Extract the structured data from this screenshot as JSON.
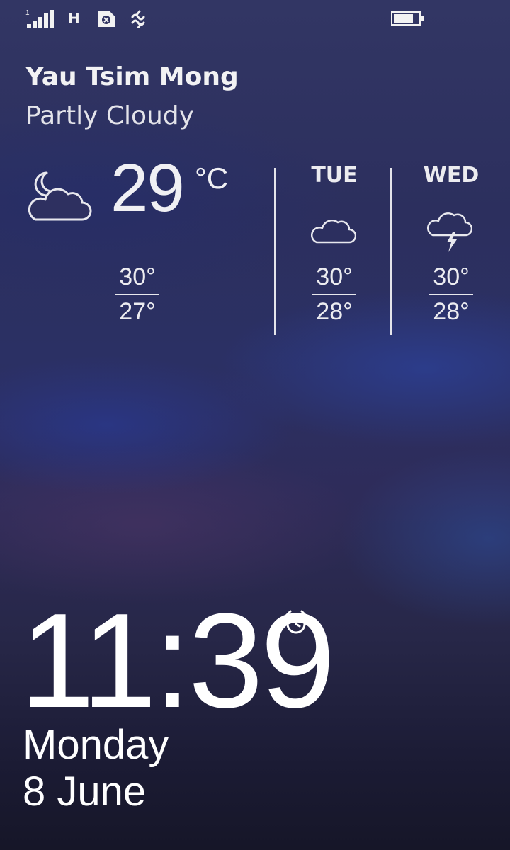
{
  "status_bar": {
    "sim_slot": "1",
    "network_type": "H",
    "icons": [
      "signal-strength-icon",
      "network-type-h",
      "sim-icon",
      "vibrate-icon",
      "battery-icon"
    ],
    "battery_level": 0.8
  },
  "weather": {
    "location": "Yau Tsim Mong",
    "condition": "Partly Cloudy",
    "current": {
      "icon": "partly-cloudy-night-icon",
      "temperature": "29",
      "unit": "°C",
      "high": "30°",
      "low": "27°"
    },
    "forecast": [
      {
        "day": "TUE",
        "icon": "cloud-icon",
        "high": "30°",
        "low": "28°"
      },
      {
        "day": "WED",
        "icon": "thunderstorm-icon",
        "high": "30°",
        "low": "28°"
      }
    ]
  },
  "clock": {
    "time": "11:39",
    "alarm_icon": "alarm-clock-icon",
    "weekday": "Monday",
    "date": "8 June"
  },
  "colors": {
    "text": "#ffffff",
    "background_top": "#323664",
    "background_bottom": "#161628"
  }
}
